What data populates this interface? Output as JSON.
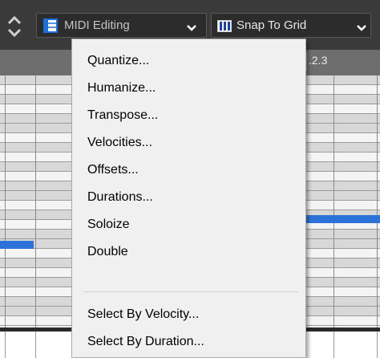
{
  "toolbar": {
    "tool_dropdown": {
      "label": "MIDI Editing",
      "icon": "midi-editing-icon"
    },
    "snap_dropdown": {
      "label": "Snap To Grid",
      "icon": "snap-grid-icon"
    }
  },
  "ruler": {
    "label": ".2.3"
  },
  "menu": {
    "items": [
      {
        "label": "Quantize..."
      },
      {
        "label": "Humanize..."
      },
      {
        "label": "Transpose..."
      },
      {
        "label": "Velocities..."
      },
      {
        "label": "Offsets..."
      },
      {
        "label": "Durations..."
      },
      {
        "label": "Soloize"
      },
      {
        "label": "Double"
      },
      {
        "label": "Select By Velocity..."
      },
      {
        "label": "Select By Duration..."
      }
    ]
  },
  "colors": {
    "toolbar_bg": "#3a3a3a",
    "note": "#2d72d9",
    "icon_blue": "#1e6fd9"
  }
}
